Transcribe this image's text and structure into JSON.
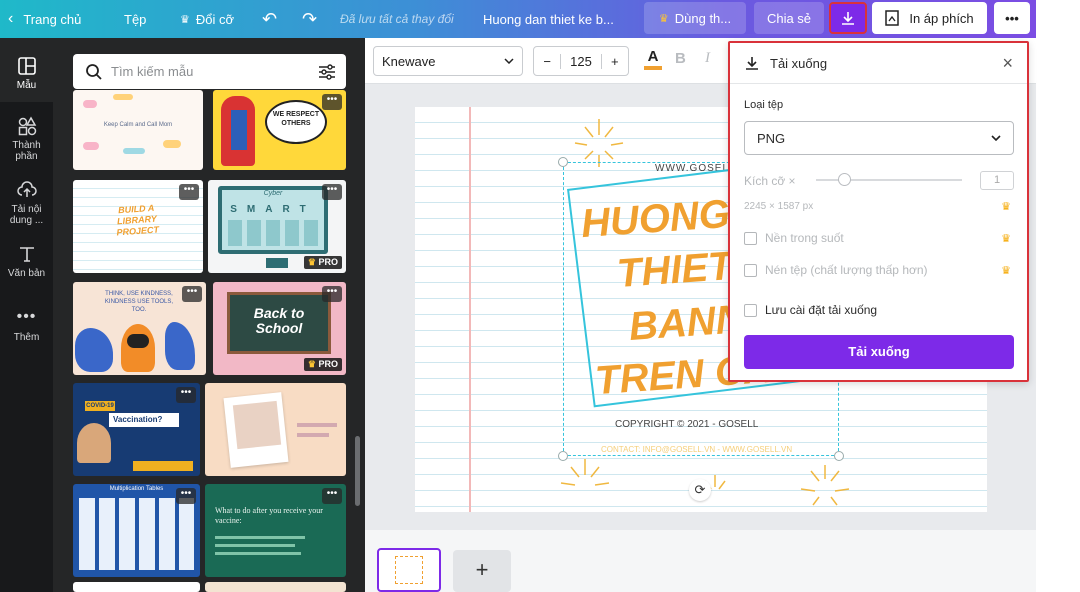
{
  "topbar": {
    "home": "Trang chủ",
    "file": "Tệp",
    "resize": "Đổi cỡ",
    "saved": "Đã lưu tất cả thay đổi",
    "title": "Huong dan thiet ke b...",
    "try": "Dùng th...",
    "share": "Chia sẻ",
    "print": "In áp phích",
    "more": "•••"
  },
  "rail": [
    {
      "label": "Mẫu",
      "icon": "template-icon"
    },
    {
      "label": "Thành phần",
      "icon": "elements-icon"
    },
    {
      "label": "Tải nội dung ...",
      "icon": "upload-icon"
    },
    {
      "label": "Văn bản",
      "icon": "text-icon"
    },
    {
      "label": "Thêm",
      "icon": "more-icon"
    }
  ],
  "panel": {
    "search_placeholder": "Tìm kiếm mẫu",
    "thumb_texts": {
      "calm": "Keep Calm and Call Mom",
      "respect": "WE RESPECT OTHERS",
      "library": "BUILD A LIBRARY PROJECT",
      "cyber_title": "Cyber",
      "cyber_word": "SMART",
      "kind": "THINK, USE KINDNESS, KINDNESS USE TOOLS, TOO.",
      "back": "Back to School",
      "covid": "COVID-19",
      "vaccine": "Vaccination?",
      "mult": "Multiplication Tables",
      "vacc2": "What to do after you receive your vaccine:"
    },
    "pro": "PRO"
  },
  "toolbar": {
    "font": "Knewave",
    "size": "125",
    "minus": "−",
    "plus": "+",
    "bold": "B",
    "italic": "I"
  },
  "design": {
    "url": "WWW.GOSELL",
    "h1": "HUONG",
    "h2": "THIET",
    "h3": "BANN",
    "h4": "TREN CA",
    "copyright": "COPYRIGHT © 2021 - GOSELL",
    "contact": "CONTACT: INFO@GOSELL.VN - WWW.GOSELL.VN"
  },
  "download": {
    "title": "Tải xuống",
    "filetype_label": "Loại tệp",
    "filetype_value": "PNG",
    "size_label": "Kích cỡ ×",
    "size_value": "1",
    "dims": "2245 × 1587 px",
    "opt_transparent": "Nền trong suốt",
    "opt_compress": "Nén tệp (chất lượng thấp hơn)",
    "opt_save": "Lưu cài đặt tải xuống",
    "button": "Tải xuống"
  },
  "colors": {
    "accent": "#7d2ae8",
    "highlight": "#d9323a",
    "title_orange": "#f0a030",
    "frame_cyan": "#35c4dc"
  }
}
